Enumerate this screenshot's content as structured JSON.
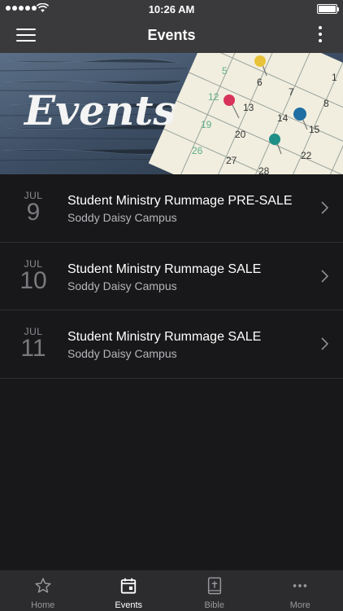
{
  "status_bar": {
    "time": "10:26 AM",
    "signal_bars": 5
  },
  "nav": {
    "title": "Events"
  },
  "banner": {
    "text": "Events",
    "calendar_numbers": [
      "5",
      "6",
      "7",
      "1",
      "12",
      "13",
      "14",
      "8",
      "19",
      "20",
      "15",
      "26",
      "27",
      "28",
      "22"
    ]
  },
  "events": [
    {
      "month": "JUL",
      "day": "9",
      "title": "Student Ministry Rummage PRE-SALE",
      "location": "Soddy Daisy Campus"
    },
    {
      "month": "JUL",
      "day": "10",
      "title": "Student Ministry Rummage SALE",
      "location": "Soddy Daisy Campus"
    },
    {
      "month": "JUL",
      "day": "11",
      "title": "Student Ministry Rummage SALE",
      "location": "Soddy Daisy Campus"
    }
  ],
  "tabs": [
    {
      "label": "Home",
      "icon": "star-icon"
    },
    {
      "label": "Events",
      "icon": "calendar-icon",
      "active": true
    },
    {
      "label": "Bible",
      "icon": "bible-icon"
    },
    {
      "label": "More",
      "icon": "ellipsis-icon"
    }
  ],
  "colors": {
    "bar": "#3a3a3c",
    "background": "#18181a",
    "tab_bar": "#2c2c2e",
    "muted": "#8e8e93"
  }
}
